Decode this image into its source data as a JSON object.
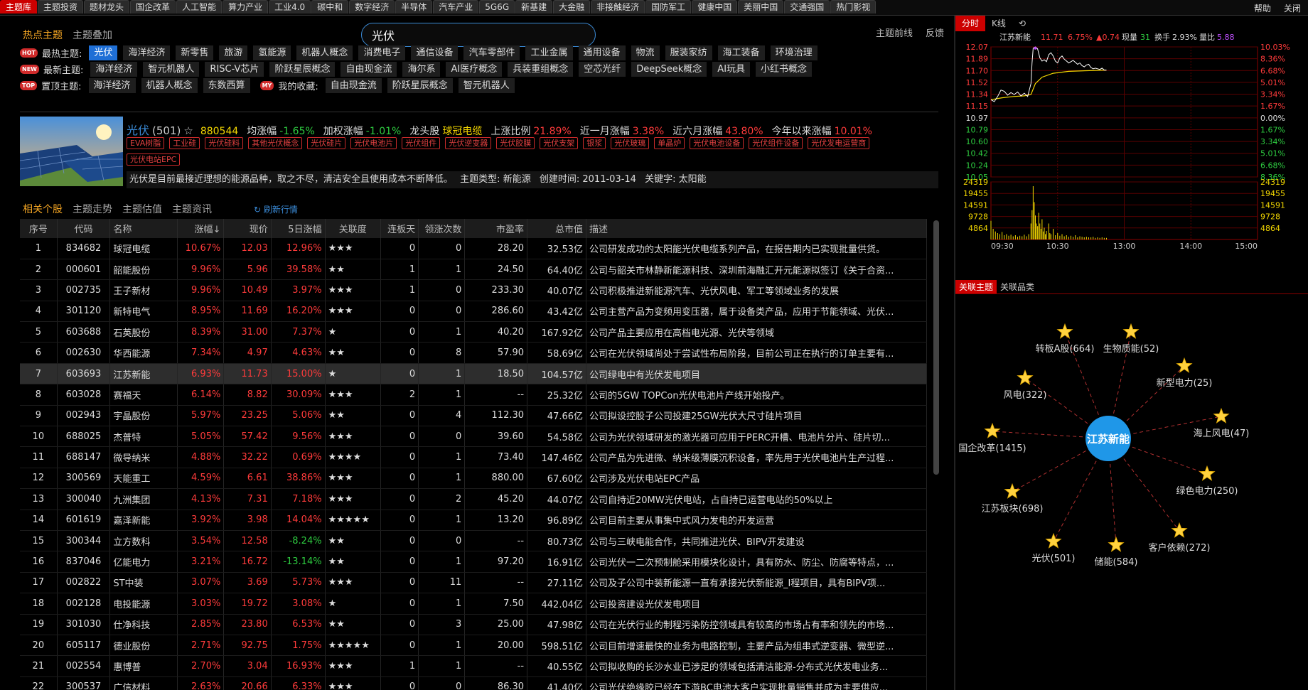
{
  "top_tabs": [
    "主题库",
    "主题投资",
    "题材龙头",
    "国企改革",
    "人工智能",
    "算力产业",
    "工业4.0",
    "碳中和",
    "数字经济",
    "半导体",
    "汽车产业",
    "5G6G",
    "新基建",
    "大金融",
    "非接触经济",
    "国防军工",
    "健康中国",
    "美丽中国",
    "交通强国",
    "热门影视"
  ],
  "top_right": {
    "help": "帮助",
    "close": "关闭"
  },
  "sub_tabs": [
    "热点主题",
    "主题叠加"
  ],
  "search": {
    "value": "光伏"
  },
  "right_links": [
    "主题前线",
    "反馈"
  ],
  "tag_rows": [
    {
      "badge": "HOT",
      "label": "最热主题:",
      "items": [
        "光伏",
        "海洋经济",
        "新零售",
        "旅游",
        "氢能源",
        "机器人概念",
        "消费电子",
        "通信设备",
        "汽车零部件",
        "工业金属",
        "通用设备",
        "物流",
        "服装家纺",
        "海工装备",
        "环境治理"
      ],
      "highlight": 0
    },
    {
      "badge": "NEW",
      "label": "最新主题:",
      "items": [
        "海洋经济",
        "智元机器人",
        "RISC-V芯片",
        "阶跃星辰概念",
        "自由现金流",
        "海尔系",
        "AI医疗概念",
        "兵装重组概念",
        "空芯光纤",
        "DeepSeek概念",
        "AI玩具",
        "小红书概念"
      ]
    },
    {
      "badge": "TOP",
      "label": "置顶主题:",
      "items": [
        "海洋经济",
        "机器人概念",
        "东数西算"
      ],
      "my_badge": "MY",
      "my_label": "我的收藏:",
      "my_items": [
        "自由现金流",
        "阶跃星辰概念",
        "智元机器人"
      ]
    }
  ],
  "theme": {
    "name": "光伏",
    "count": "(501)",
    "star": "☆",
    "code": "880544",
    "avg_label": "均涨幅",
    "avg": "-1.65%",
    "w_label": "加权涨幅",
    "w": "-1.01%",
    "lead_label": "龙头股",
    "lead": "球冠电缆",
    "up_label": "上涨比例",
    "up": "21.89%",
    "m1_label": "近一月涨幅",
    "m1": "3.38%",
    "m6_label": "近六月涨幅",
    "m6": "43.80%",
    "ytd_label": "今年以来涨幅",
    "ytd": "10.01%",
    "tags": [
      "EVA树脂",
      "工业硅",
      "光伏硅料",
      "其他光伏概念",
      "光伏硅片",
      "光伏电池片",
      "光伏组件",
      "光伏逆变器",
      "光伏胶膜",
      "光伏支架",
      "银浆",
      "光伏玻璃",
      "单晶炉",
      "光伏电池设备",
      "光伏组件设备",
      "光伏发电运营商",
      "光伏电站EPC"
    ],
    "desc": "光伏是目前最接近理想的能源品种，取之不尽，清洁安全且使用成本不断降低。",
    "type_label": "主题类型:",
    "type": "新能源",
    "created_label": "创建时间:",
    "created": "2011-03-14",
    "kw_label": "关键字:",
    "kw": "太阳能"
  },
  "list_tabs": [
    "相关个股",
    "主题走势",
    "主题估值",
    "主题资讯"
  ],
  "refresh_label": "刷新行情",
  "table": {
    "columns": [
      "序号",
      "代码",
      "名称",
      "涨幅↓",
      "现价",
      "5日涨幅",
      "关联度",
      "连板天",
      "领涨次数",
      "市盈率",
      "总市值",
      "描述"
    ],
    "selected_row": 6,
    "rows": [
      [
        "1",
        "834682",
        "球冠电缆",
        "10.67%",
        "12.03",
        "12.96%",
        "★★★",
        "0",
        "0",
        "28.20",
        "32.53亿",
        "公司研发成功的太阳能光伏电缆系列产品，在报告期内已实现批量供货。"
      ],
      [
        "2",
        "000601",
        "韶能股份",
        "9.96%",
        "5.96",
        "39.58%",
        "★★",
        "1",
        "1",
        "24.50",
        "64.40亿",
        "公司与韶关市林静新能源科技、深圳前海融汇开元能源拟签订《关于合资..."
      ],
      [
        "3",
        "002735",
        "王子新材",
        "9.96%",
        "10.49",
        "3.97%",
        "★★★",
        "1",
        "0",
        "233.30",
        "40.07亿",
        "公司积极推进新能源汽车、光伏风电、军工等领域业务的发展"
      ],
      [
        "4",
        "301120",
        "新特电气",
        "8.95%",
        "11.69",
        "16.20%",
        "★★★",
        "0",
        "0",
        "286.60",
        "43.42亿",
        "公司主营产品为变频用变压器，属于设备类产品，应用于节能领域、光伏..."
      ],
      [
        "5",
        "603688",
        "石英股份",
        "8.39%",
        "31.00",
        "7.37%",
        "★",
        "0",
        "1",
        "40.20",
        "167.92亿",
        "公司产品主要应用在高档电光源、光伏等领域"
      ],
      [
        "6",
        "002630",
        "华西能源",
        "7.34%",
        "4.97",
        "4.63%",
        "★★",
        "0",
        "8",
        "57.90",
        "58.69亿",
        "公司在光伏领域尚处于尝试性布局阶段，目前公司正在执行的订单主要有..."
      ],
      [
        "7",
        "603693",
        "江苏新能",
        "6.93%",
        "11.73",
        "15.00%",
        "★",
        "0",
        "1",
        "18.50",
        "104.57亿",
        "公司绿电中有光伏发电项目"
      ],
      [
        "8",
        "603028",
        "赛福天",
        "6.14%",
        "8.82",
        "30.09%",
        "★★★",
        "2",
        "1",
        "--",
        "25.32亿",
        "公司的5GW TOPCon光伏电池片产线开始投产。"
      ],
      [
        "9",
        "002943",
        "宇晶股份",
        "5.97%",
        "23.25",
        "5.06%",
        "★★",
        "0",
        "4",
        "112.30",
        "47.66亿",
        "公司拟设控股子公司投建25GW光伏大尺寸硅片项目"
      ],
      [
        "10",
        "688025",
        "杰普特",
        "5.05%",
        "57.42",
        "9.56%",
        "★★★",
        "0",
        "0",
        "39.60",
        "54.58亿",
        "公司为光伏领域研发的激光器可应用于PERC开槽、电池片分片、硅片切..."
      ],
      [
        "11",
        "688147",
        "微导纳米",
        "4.88%",
        "32.22",
        "0.69%",
        "★★★★",
        "0",
        "1",
        "73.40",
        "147.46亿",
        "公司产品为先进微、纳米级薄膜沉积设备，率先用于光伏电池片生产过程..."
      ],
      [
        "12",
        "300569",
        "天能重工",
        "4.59%",
        "6.61",
        "38.86%",
        "★★★",
        "0",
        "1",
        "880.00",
        "67.60亿",
        "公司涉及光伏电站EPC产品"
      ],
      [
        "13",
        "300040",
        "九洲集团",
        "4.13%",
        "7.31",
        "7.18%",
        "★★★",
        "0",
        "2",
        "45.20",
        "44.07亿",
        "公司自持近20MW光伏电站，占自持已运营电站的50%以上"
      ],
      [
        "14",
        "601619",
        "嘉泽新能",
        "3.92%",
        "3.98",
        "14.04%",
        "★★★★★",
        "0",
        "1",
        "13.20",
        "96.89亿",
        "公司目前主要从事集中式风力发电的开发运营"
      ],
      [
        "15",
        "300344",
        "立方数科",
        "3.54%",
        "12.58",
        "-8.24%",
        "★★",
        "0",
        "0",
        "--",
        "80.73亿",
        "公司与三峡电能合作，共同推进光伏、BIPV开发建设"
      ],
      [
        "16",
        "837046",
        "亿能电力",
        "3.21%",
        "16.72",
        "-13.14%",
        "★★",
        "0",
        "1",
        "97.20",
        "16.91亿",
        "公司光伏一二次预制舱采用模块化设计，具有防水、防尘、防腐等特点，..."
      ],
      [
        "17",
        "002822",
        "ST中装",
        "3.07%",
        "3.69",
        "5.73%",
        "★★★",
        "0",
        "11",
        "--",
        "27.11亿",
        "公司及子公司中装新能源一直有承接光伏新能源_I程项目，具有BIPV项..."
      ],
      [
        "18",
        "002128",
        "电投能源",
        "3.03%",
        "19.72",
        "3.08%",
        "★",
        "0",
        "1",
        "7.50",
        "442.04亿",
        "公司投资建设光伏发电项目"
      ],
      [
        "19",
        "301030",
        "仕净科技",
        "2.85%",
        "23.80",
        "6.53%",
        "★★",
        "0",
        "3",
        "25.00",
        "47.98亿",
        "公司在光伏行业的制程污染防控领域具有较高的市场占有率和领先的市场..."
      ],
      [
        "20",
        "605117",
        "德业股份",
        "2.71%",
        "92.75",
        "1.75%",
        "★★★★★",
        "0",
        "1",
        "20.00",
        "598.51亿",
        "公司目前增速最快的业务为电路控制，主要产品为组串式逆变器、微型逆..."
      ],
      [
        "21",
        "002554",
        "惠博普",
        "2.70%",
        "3.04",
        "16.93%",
        "★★★",
        "1",
        "1",
        "--",
        "40.55亿",
        "公司拟收购的长沙水业已涉足的领域包括清洁能源-分布式光伏发电业务..."
      ],
      [
        "22",
        "300537",
        "广信材料",
        "2.63%",
        "20.66",
        "6.33%",
        "★★★",
        "0",
        "0",
        "86.30",
        "41.40亿",
        "公司光伏绝缘胶已经在下游BC电池大客户实现批量销售并成为主要供应..."
      ]
    ]
  },
  "chart_tabs": [
    "分时",
    "K线",
    "⟲"
  ],
  "chart_data": {
    "type": "line",
    "title": "江苏新能",
    "header": {
      "price": "11.71",
      "pct": "6.75%",
      "chg": "▲0.74",
      "vol_label": "现量",
      "vol": "31",
      "turn_label": "换手",
      "turn": "2.93%",
      "ratio_label": "量比",
      "ratio": "5.88"
    },
    "price_axis": [
      "12.07",
      "11.89",
      "11.70",
      "11.52",
      "11.34",
      "11.15",
      "10.97",
      "10.79",
      "10.60",
      "10.42",
      "10.24",
      "10.05"
    ],
    "pct_axis": [
      "10.03%",
      "8.36%",
      "6.68%",
      "5.01%",
      "3.34%",
      "1.67%",
      "0.00%",
      "1.67%",
      "3.34%",
      "5.01%",
      "6.68%",
      "8.36%"
    ],
    "vol_axis": [
      "24319",
      "19455",
      "14591",
      "9728",
      "4864"
    ],
    "x_ticks": [
      "09:30",
      "10:30",
      "13:00",
      "14:00",
      "15:00"
    ],
    "ylim": [
      10.05,
      12.07
    ],
    "prev_close": 10.97,
    "minutes_total": 240,
    "price": [
      [
        0,
        11.25
      ],
      [
        3,
        11.22
      ],
      [
        6,
        11.3
      ],
      [
        9,
        11.4
      ],
      [
        12,
        11.38
      ],
      [
        15,
        11.32
      ],
      [
        18,
        11.36
      ],
      [
        21,
        11.33
      ],
      [
        24,
        11.37
      ],
      [
        27,
        11.31
      ],
      [
        30,
        11.35
      ],
      [
        33,
        11.3
      ],
      [
        36,
        11.5
      ],
      [
        37,
        11.82
      ],
      [
        38,
        12.05
      ],
      [
        40,
        12.07
      ],
      [
        42,
        12.04
      ],
      [
        44,
        11.9
      ],
      [
        46,
        11.85
      ],
      [
        48,
        11.87
      ],
      [
        50,
        11.84
      ],
      [
        52,
        11.95
      ],
      [
        54,
        11.98
      ],
      [
        56,
        11.93
      ],
      [
        58,
        11.85
      ],
      [
        60,
        11.82
      ],
      [
        62,
        11.9
      ],
      [
        64,
        11.93
      ],
      [
        66,
        11.88
      ],
      [
        68,
        11.85
      ],
      [
        70,
        11.82
      ],
      [
        72,
        11.84
      ],
      [
        74,
        11.86
      ],
      [
        76,
        11.83
      ],
      [
        78,
        11.8
      ],
      [
        80,
        11.82
      ],
      [
        82,
        11.78
      ],
      [
        84,
        11.76
      ],
      [
        86,
        11.79
      ],
      [
        88,
        11.8
      ],
      [
        90,
        11.75
      ],
      [
        92,
        11.73
      ],
      [
        94,
        11.74
      ],
      [
        96,
        11.73
      ],
      [
        98,
        11.72
      ],
      [
        100,
        11.74
      ],
      [
        102,
        11.71
      ],
      [
        104,
        11.71
      ]
    ],
    "avg": [
      [
        0,
        11.25
      ],
      [
        10,
        11.28
      ],
      [
        20,
        11.3
      ],
      [
        30,
        11.31
      ],
      [
        36,
        11.33
      ],
      [
        40,
        11.5
      ],
      [
        46,
        11.6
      ],
      [
        56,
        11.66
      ],
      [
        70,
        11.69
      ],
      [
        86,
        11.7
      ],
      [
        104,
        11.71
      ]
    ],
    "volume": [
      [
        0,
        0.35
      ],
      [
        2,
        0.2
      ],
      [
        4,
        0.15
      ],
      [
        6,
        0.12
      ],
      [
        8,
        0.1
      ],
      [
        10,
        0.14
      ],
      [
        12,
        0.08
      ],
      [
        14,
        0.1
      ],
      [
        16,
        0.07
      ],
      [
        18,
        0.09
      ],
      [
        20,
        0.06
      ],
      [
        22,
        0.08
      ],
      [
        24,
        0.05
      ],
      [
        26,
        0.07
      ],
      [
        28,
        0.06
      ],
      [
        30,
        0.09
      ],
      [
        32,
        0.06
      ],
      [
        34,
        0.1
      ],
      [
        36,
        0.3
      ],
      [
        37,
        0.55
      ],
      [
        38,
        1.0
      ],
      [
        39,
        0.7
      ],
      [
        40,
        0.45
      ],
      [
        41,
        0.3
      ],
      [
        42,
        0.25
      ],
      [
        43,
        0.5
      ],
      [
        44,
        0.3
      ],
      [
        45,
        0.2
      ],
      [
        46,
        0.38
      ],
      [
        47,
        0.15
      ],
      [
        48,
        0.22
      ],
      [
        49,
        0.1
      ],
      [
        50,
        0.16
      ],
      [
        52,
        0.3
      ],
      [
        53,
        0.12
      ],
      [
        54,
        0.1
      ],
      [
        56,
        0.2
      ],
      [
        58,
        0.08
      ],
      [
        60,
        0.12
      ],
      [
        62,
        0.07
      ],
      [
        64,
        0.1
      ],
      [
        66,
        0.06
      ],
      [
        68,
        0.08
      ],
      [
        70,
        0.05
      ],
      [
        72,
        0.07
      ],
      [
        74,
        0.05
      ],
      [
        76,
        0.08
      ],
      [
        78,
        0.04
      ],
      [
        80,
        0.06
      ],
      [
        82,
        0.05
      ],
      [
        84,
        0.04
      ],
      [
        86,
        0.05
      ],
      [
        88,
        0.04
      ],
      [
        90,
        0.04
      ],
      [
        92,
        0.05
      ],
      [
        94,
        0.03
      ],
      [
        96,
        0.04
      ],
      [
        98,
        0.03
      ],
      [
        100,
        0.04
      ],
      [
        102,
        0.03
      ],
      [
        104,
        0.03
      ]
    ]
  },
  "relation_tabs": [
    "关联主题",
    "关联品类"
  ],
  "graph": {
    "center": "江苏新能",
    "nodes": [
      "生物质能(52)",
      "新型电力(25)",
      "海上风电(47)",
      "绿色电力(250)",
      "客户依赖(272)",
      "储能(584)",
      "光伏(501)",
      "江苏板块(698)",
      "国企改革(1415)",
      "风电(322)",
      "转板A股(664)"
    ]
  },
  "colors": {
    "up": "#ff3b3b",
    "down": "#2ecc40",
    "accent": "#f5a623",
    "highlight": "#1f6fd6",
    "node": "#1f97e8"
  }
}
